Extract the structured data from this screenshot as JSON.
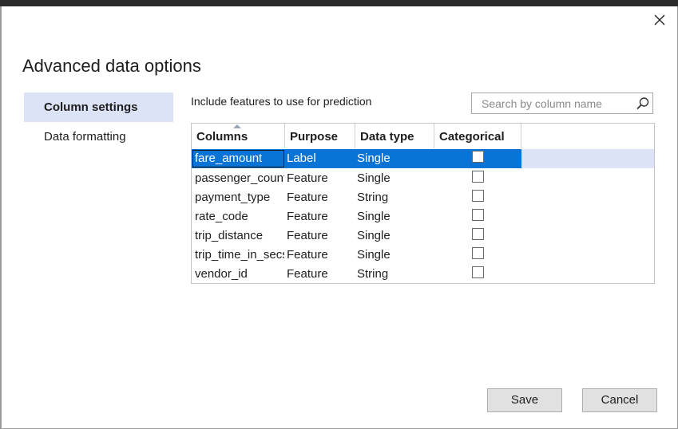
{
  "dialog": {
    "title": "Advanced data options"
  },
  "nav": {
    "items": [
      {
        "label": "Column settings",
        "active": true
      },
      {
        "label": "Data formatting",
        "active": false
      }
    ]
  },
  "content": {
    "instruction": "Include features to use for prediction",
    "search": {
      "placeholder": "Search by column name",
      "value": ""
    }
  },
  "grid": {
    "headers": [
      "Columns",
      "Purpose",
      "Data type",
      "Categorical"
    ],
    "sorted_column": "Columns",
    "rows": [
      {
        "column": "fare_amount",
        "purpose": "Label",
        "data_type": "Single",
        "categorical": false,
        "selected": true
      },
      {
        "column": "passenger_count",
        "purpose": "Feature",
        "data_type": "Single",
        "categorical": false,
        "selected": false
      },
      {
        "column": "payment_type",
        "purpose": "Feature",
        "data_type": "String",
        "categorical": false,
        "selected": false
      },
      {
        "column": "rate_code",
        "purpose": "Feature",
        "data_type": "Single",
        "categorical": false,
        "selected": false
      },
      {
        "column": "trip_distance",
        "purpose": "Feature",
        "data_type": "Single",
        "categorical": false,
        "selected": false
      },
      {
        "column": "trip_time_in_secs",
        "purpose": "Feature",
        "data_type": "Single",
        "categorical": false,
        "selected": false
      },
      {
        "column": "vendor_id",
        "purpose": "Feature",
        "data_type": "String",
        "categorical": false,
        "selected": false
      }
    ]
  },
  "buttons": {
    "save_label": "Save",
    "cancel_label": "Cancel"
  },
  "icons": {
    "close": "close-icon",
    "search": "search-icon",
    "sort": "sort-ascending-icon"
  },
  "colors": {
    "selected_row": "#0a74d6",
    "nav_active": "#dde3f6"
  }
}
